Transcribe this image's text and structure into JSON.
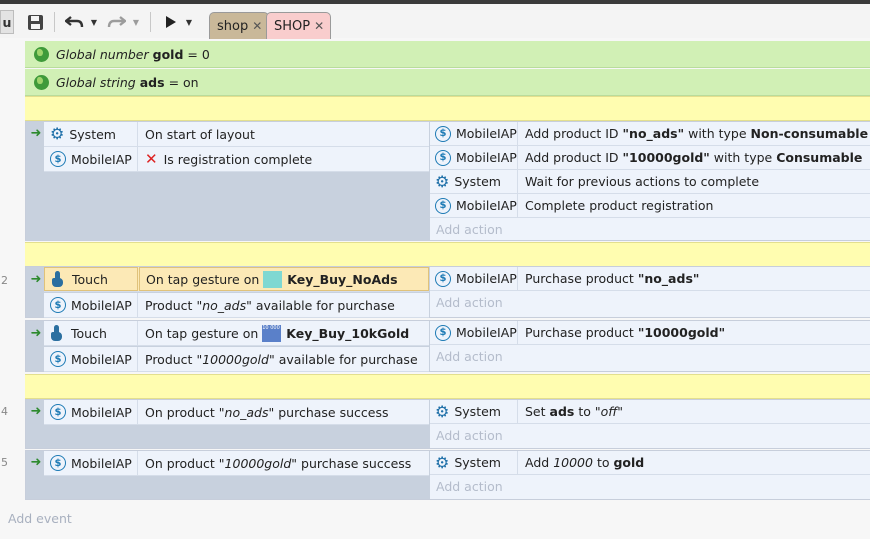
{
  "toolbar": {
    "left_btn_label": "u",
    "tabs": [
      {
        "label": "shop",
        "color": "#c8b89a"
      },
      {
        "label": "SHOP",
        "color": "#f8c8c8"
      }
    ],
    "icons": [
      "save-icon",
      "undo-icon",
      "redo-icon",
      "play-icon",
      "chevron-down-icon"
    ]
  },
  "globals": [
    {
      "prefix": "Global number",
      "name": "gold",
      "eq": "= 0"
    },
    {
      "prefix": "Global string",
      "name": "ads",
      "eq": "= on"
    }
  ],
  "events": {
    "e1": {
      "conditions": [
        {
          "object": "System",
          "text": "On start of layout"
        },
        {
          "object": "MobileIAP",
          "text": "Is registration complete"
        }
      ],
      "actions": [
        {
          "object": "MobileIAP",
          "pre": "Add product ID ",
          "id": "\"no_ads\"",
          "mid": " with type ",
          "type": "Non-consumable"
        },
        {
          "object": "MobileIAP",
          "pre": "Add product ID ",
          "id": "\"10000gold\"",
          "mid": " with type ",
          "type": "Consumable"
        },
        {
          "object": "System",
          "text": "Wait for previous actions to complete"
        },
        {
          "object": "MobileIAP",
          "text": "Complete product registration"
        }
      ]
    },
    "e2": {
      "number": "2",
      "conditions": [
        {
          "object": "Touch",
          "pre": "On tap gesture on",
          "target": "Key_Buy_NoAds"
        },
        {
          "object": "MobileIAP",
          "pre": "Product ",
          "product": "\"no_ads\"",
          "post": " available for purchase"
        }
      ],
      "actions": [
        {
          "object": "MobileIAP",
          "pre": "Purchase product ",
          "product": "\"no_ads\""
        }
      ]
    },
    "e3": {
      "conditions": [
        {
          "object": "Touch",
          "pre": "On tap gesture on",
          "target": "Key_Buy_10kGold",
          "thumb_text": "10 000 Gold"
        },
        {
          "object": "MobileIAP",
          "pre": "Product ",
          "product": "\"10000gold\"",
          "post": " available for purchase"
        }
      ],
      "actions": [
        {
          "object": "MobileIAP",
          "pre": "Purchase product ",
          "product": "\"10000gold\""
        }
      ]
    },
    "e4": {
      "number": "4",
      "conditions": [
        {
          "object": "MobileIAP",
          "pre": "On product ",
          "product": "\"no_ads\"",
          "post": " purchase success"
        }
      ],
      "actions": [
        {
          "object": "System",
          "pre": "Set ",
          "var": "ads",
          "mid": " to ",
          "val": "\"off\""
        }
      ]
    },
    "e5": {
      "number": "5",
      "conditions": [
        {
          "object": "MobileIAP",
          "pre": "On product ",
          "product": "\"10000gold\"",
          "post": " purchase success"
        }
      ],
      "actions": [
        {
          "object": "System",
          "pre": "Add ",
          "amount": "10000",
          "mid": " to ",
          "var": "gold"
        }
      ]
    }
  },
  "add_action_label": "Add action",
  "add_event_label": "Add event",
  "colors": {
    "global_var_bg": "#d1f0b5",
    "comment_bg": "#fffdb0",
    "condition_bg": "#eef3fb",
    "highlight_bg": "#fce9b6",
    "event_body_bg": "#c8d1de",
    "accent": "#1e7bb5"
  }
}
